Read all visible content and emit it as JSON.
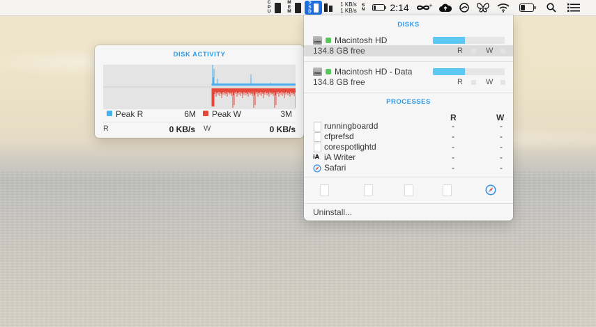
{
  "menubar": {
    "cpu_letters": [
      "C",
      "P",
      "U"
    ],
    "mem_letters": [
      "M",
      "E",
      "M"
    ],
    "ssd_letters": [
      "S",
      "S",
      "D"
    ],
    "net_letters": [
      "S",
      "N"
    ],
    "net_up": "1 KB/s",
    "net_down": "1 KB/s",
    "clock": "2:14"
  },
  "disk_activity": {
    "title": "DISK ACTIVITY",
    "peak_r_label": "Peak R",
    "peak_r_value": "6M",
    "peak_w_label": "Peak W",
    "peak_w_value": "3M",
    "r_label": "R",
    "r_value": "0 KB/s",
    "w_label": "W",
    "w_value": "0 KB/s",
    "colors": {
      "read": "#4ab1ee",
      "write": "#e5473b"
    }
  },
  "disks": {
    "title": "DISKS",
    "items": [
      {
        "name": "Macintosh HD",
        "free": "134.8 GB free",
        "usage": 0.45,
        "r": "R",
        "w": "W"
      },
      {
        "name": "Macintosh HD - Data",
        "free": "134.8 GB free",
        "usage": 0.45,
        "r": "R",
        "w": "W"
      }
    ]
  },
  "processes": {
    "title": "PROCESSES",
    "col_r": "R",
    "col_w": "W",
    "rows": [
      {
        "name": "runningboardd",
        "r": "-",
        "w": "-"
      },
      {
        "name": "cfprefsd",
        "r": "-",
        "w": "-"
      },
      {
        "name": "corespotlightd",
        "r": "-",
        "w": "-"
      },
      {
        "name": "iA Writer",
        "r": "-",
        "w": "-",
        "icon_text": "iA"
      },
      {
        "name": "Safari",
        "r": "-",
        "w": "-"
      }
    ]
  },
  "footer": {
    "uninstall": "Uninstall..."
  }
}
